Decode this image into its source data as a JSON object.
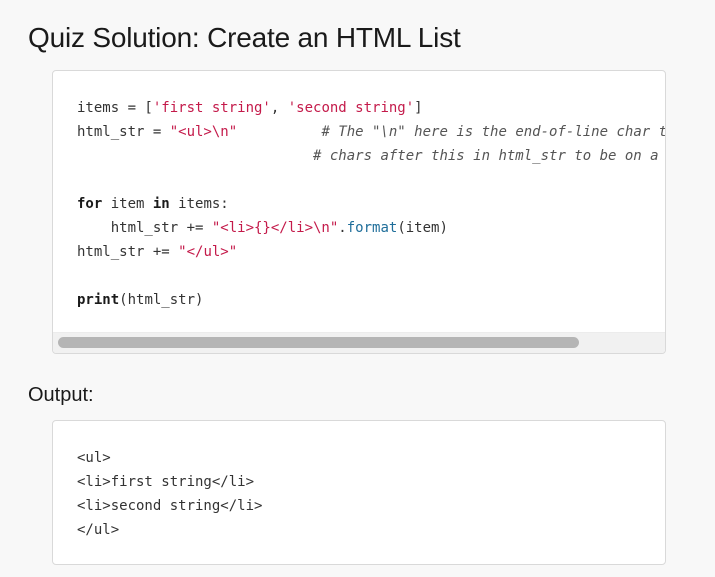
{
  "page": {
    "title": "Quiz Solution: Create an HTML List",
    "output_label": "Output:"
  },
  "code": {
    "l1_a": "items = [",
    "l1_s1": "'first string'",
    "l1_c": ", ",
    "l1_s2": "'second string'",
    "l1_e": "]",
    "l2_a": "html_str = ",
    "l2_s": "\"<ul>\\n\"",
    "l2_pad": "          ",
    "l2_cm": "# The \"\\n\" here is the end-of-line char that causes",
    "l3_pad": "                            ",
    "l3_cm": "# chars after this in html_str to be on a new line",
    "l4_kw1": "for",
    "l4_a": " item ",
    "l4_kw2": "in",
    "l4_b": " items:",
    "l5_a": "    html_str += ",
    "l5_s": "\"<li>{}</li>\\n\"",
    "l5_dot": ".",
    "l5_fn": "format",
    "l5_b": "(item)",
    "l6_a": "html_str += ",
    "l6_s": "\"</ul>\"",
    "l7_kw": "print",
    "l7_a": "(html_str)"
  },
  "output": {
    "lines": [
      "<ul>",
      "<li>first string</li>",
      "<li>second string</li>",
      "</ul>"
    ]
  },
  "scrollbar": {
    "position_fraction": 0.0,
    "visible_fraction": 0.85
  }
}
